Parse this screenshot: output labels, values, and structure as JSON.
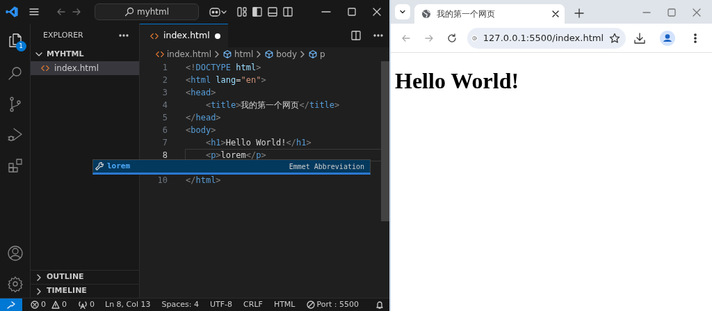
{
  "vscode": {
    "search": "myhtml",
    "activity_badge": "1",
    "explorer": {
      "title": "EXPLORER",
      "folder": {
        "label": "MYHTML",
        "expanded": true,
        "children": [
          {
            "label": "index.html",
            "selected": true
          }
        ]
      },
      "sections": [
        {
          "label": "OUTLINE",
          "expanded": false
        },
        {
          "label": "TIMELINE",
          "expanded": false
        }
      ]
    },
    "editor_tab": {
      "label": "index.html",
      "selected": true,
      "modified": true
    },
    "breadcrumb": [
      {
        "label": "index.html",
        "kind": "file"
      },
      {
        "label": "html",
        "kind": "element"
      },
      {
        "label": "body",
        "kind": "element"
      },
      {
        "label": "p",
        "kind": "element"
      }
    ],
    "code_lines": [
      {
        "number": "1",
        "current": false,
        "tokens": [
          {
            "kind": "punct",
            "text": "<!"
          },
          {
            "kind": "tag",
            "text": "DOCTYPE"
          },
          {
            "kind": "attr",
            "text": " html"
          },
          {
            "kind": "punct",
            "text": ">"
          }
        ]
      },
      {
        "number": "2",
        "current": false,
        "tokens": [
          {
            "kind": "punct",
            "text": "<"
          },
          {
            "kind": "tag",
            "text": "html"
          },
          {
            "kind": "attr",
            "text": " lang"
          },
          {
            "kind": "text",
            "text": "="
          },
          {
            "kind": "string",
            "text": "\"en\""
          },
          {
            "kind": "punct",
            "text": ">"
          }
        ]
      },
      {
        "number": "3",
        "current": false,
        "tokens": [
          {
            "kind": "punct",
            "text": "<"
          },
          {
            "kind": "tag",
            "text": "head"
          },
          {
            "kind": "punct",
            "text": ">"
          }
        ]
      },
      {
        "number": "4",
        "current": false,
        "tokens": [
          {
            "kind": "punct",
            "text": "    <"
          },
          {
            "kind": "tag",
            "text": "title"
          },
          {
            "kind": "punct",
            "text": ">"
          },
          {
            "kind": "text",
            "text": "我的第一个网页"
          },
          {
            "kind": "punct",
            "text": "</"
          },
          {
            "kind": "tag",
            "text": "title"
          },
          {
            "kind": "punct",
            "text": ">"
          }
        ]
      },
      {
        "number": "5",
        "current": false,
        "tokens": [
          {
            "kind": "punct",
            "text": "</"
          },
          {
            "kind": "tag",
            "text": "head"
          },
          {
            "kind": "punct",
            "text": ">"
          }
        ]
      },
      {
        "number": "6",
        "current": false,
        "tokens": [
          {
            "kind": "punct",
            "text": "<"
          },
          {
            "kind": "tag",
            "text": "body"
          },
          {
            "kind": "punct",
            "text": ">"
          }
        ]
      },
      {
        "number": "7",
        "current": false,
        "tokens": [
          {
            "kind": "punct",
            "text": "    <"
          },
          {
            "kind": "tag",
            "text": "h1"
          },
          {
            "kind": "punct",
            "text": ">"
          },
          {
            "kind": "text",
            "text": "Hello World!"
          },
          {
            "kind": "punct",
            "text": "</"
          },
          {
            "kind": "tag",
            "text": "h1"
          },
          {
            "kind": "punct",
            "text": ">"
          }
        ]
      },
      {
        "number": "8",
        "current": true,
        "tokens": [
          {
            "kind": "punct",
            "text": "    <"
          },
          {
            "kind": "tag",
            "text": "p"
          },
          {
            "kind": "punct",
            "text": ">"
          },
          {
            "kind": "text",
            "text": "lorem"
          },
          {
            "kind": "punct",
            "text": "</"
          },
          {
            "kind": "tag",
            "text": "p"
          },
          {
            "kind": "punct",
            "text": ">"
          }
        ]
      },
      {
        "number": "10",
        "current": false,
        "tokens": [
          {
            "kind": "punct",
            "text": "</"
          },
          {
            "kind": "tag",
            "text": "html"
          },
          {
            "kind": "punct",
            "text": ">"
          }
        ]
      }
    ],
    "suggestion": {
      "label": "lorem",
      "detail": "Emmet Abbreviation"
    },
    "status_bar": {
      "errors": "0",
      "warnings": "0",
      "ports": "0",
      "position": "Ln 8, Col 13",
      "indent": "Spaces: 4",
      "encoding": "UTF-8",
      "eol": "CRLF",
      "language": "HTML",
      "live_server": "Port : 5500"
    }
  },
  "browser": {
    "tab": {
      "title": "我的第一个网页",
      "selected": true
    },
    "address": "127.0.0.1:5500/index.html",
    "page": {
      "heading": "Hello World!"
    }
  }
}
